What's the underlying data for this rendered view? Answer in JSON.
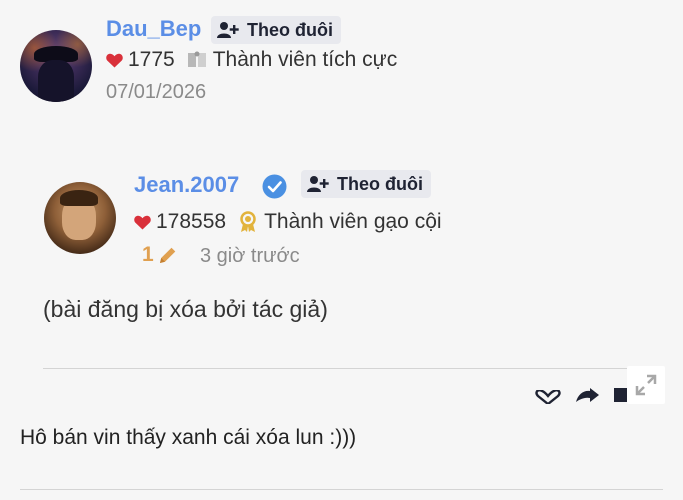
{
  "post1": {
    "username": "Dau_Bep",
    "follow_label": "Theo đuôi",
    "likes": "1775",
    "rank": "Thành viên tích cực",
    "date": "07/01/2026"
  },
  "post2": {
    "username": "Jean.2007",
    "follow_label": "Theo đuôi",
    "likes": "178558",
    "rank": "Thành viên gạo cội",
    "edit_count": "1",
    "time_ago": "3 giờ trước",
    "content": "(bài đăng bị xóa bởi tác giả)"
  },
  "reply": {
    "text": "Hô bán vin thấy xanh cái xóa lun :)))"
  },
  "colors": {
    "username": "#5b8ee6",
    "heart": "#d9303a",
    "verified": "#4a90e2",
    "award": "#e2b33c",
    "edit": "#e0a050"
  },
  "icons": [
    "user-plus-icon",
    "heart-icon",
    "book-icon",
    "award-icon",
    "verified-icon",
    "pencil-icon",
    "like-outline-icon",
    "share-icon",
    "bookmark-icon",
    "expand-icon"
  ]
}
